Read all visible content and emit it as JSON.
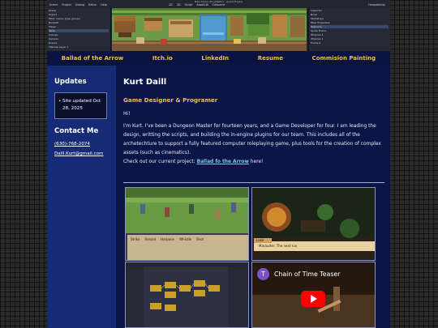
{
  "editor": {
    "window_title": "Main Scene (Proj)Sketch - Godot Engine",
    "menu": [
      "Scene",
      "Project",
      "Debug",
      "Editor",
      "Help"
    ],
    "center_tabs": [
      "2D",
      "3D",
      "Script",
      "AssetLib",
      "Cutscene"
    ],
    "right_label": "Compatibility",
    "scene_rows": [
      "Scene",
      "Import",
      "Filter: name, type, groups",
      "Node2D",
      "Player",
      "Table",
      "pickups",
      "Camera",
      "Events",
      "Tilemap Layer 1"
    ],
    "inspector_rows": [
      "Inspector",
      "Node",
      "TableProps",
      "Filter Properties",
      "Resource",
      "Sprite Frame",
      "Hframes 1",
      "Vframes 1",
      "Frame 0"
    ]
  },
  "nav": {
    "items": [
      "Ballad of the Arrow",
      "Itch.io",
      "LinkedIn",
      "Resume",
      "Commision Painting"
    ]
  },
  "sidebar": {
    "updates_title": "Updates",
    "updates": [
      "Site updated Oct 28, 2025"
    ],
    "contact_title": "Contact Me",
    "phone": "(630)-768-2074",
    "email": "Daill.Kurt@gmail.com"
  },
  "main": {
    "name": "Kurt Daill",
    "role": "Game Designer & Programer",
    "greeting": "Hi!",
    "bio": "I'm Kurt. I've been a Dungeon Master for fourteen years, and a Game Developer for four. I am leading the design, writting the scripts, and building the in-engine plugins for our team. This includes all of the archetechture to support a fully featured computer roleplaying game, plus tools for the creation of complex assets (such as cinematics).",
    "project_prefix": "Check out our current project: ",
    "project_link": "Ballad fo the Arrow",
    "project_suffix": " here!"
  },
  "gallery": {
    "game1_labels": [
      "Strike",
      "Reload",
      "Harpoon",
      "Whistle",
      "Shot"
    ],
    "game2_dialog_speaker": "Luke",
    "game2_dialog": "Marauder: The next run",
    "video_title": "Chain of Time Teaser",
    "video_channel_initial": "T"
  },
  "colors": {
    "page_bg": "#0c1548",
    "sidebar_bg": "#162a76",
    "nav_text": "#f0c23a",
    "role_text": "#f0c23a",
    "link_text": "#7fc3f2",
    "youtube_red": "#ff0000"
  }
}
